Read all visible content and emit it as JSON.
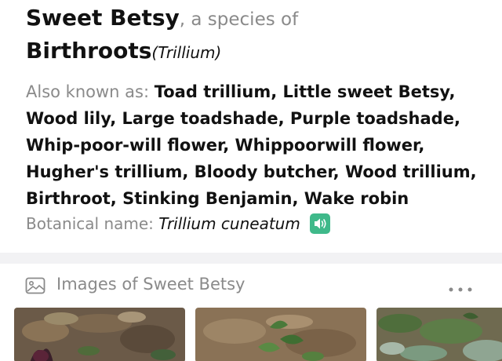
{
  "header": {
    "common_name": "Sweet Betsy",
    "species_of_text": ", a species of",
    "genus": "Birthroots",
    "genus_latin": "(Trillium)"
  },
  "also_known_as": {
    "label": "Also known as:",
    "names": "Toad trillium, Little sweet Betsy, Wood lily, Large toadshade, Purple toadshade, Whip-poor-will flower, Whippoorwill flower, Hugher's trillium, Bloody butcher, Wood trillium, Birthroot, Stinking Benjamin, Wake robin"
  },
  "botanical": {
    "label": "Botanical name:",
    "value": "Trillium cuneatum",
    "speaker_icon": "speaker-icon"
  },
  "images_section": {
    "title": "Images of Sweet Betsy",
    "icon": "image-icon",
    "more_icon": "more-icon"
  },
  "colors": {
    "accent_green": "#3fb98a",
    "secondary_text": "#8a8a8a",
    "divider": "#f2f2f4"
  }
}
